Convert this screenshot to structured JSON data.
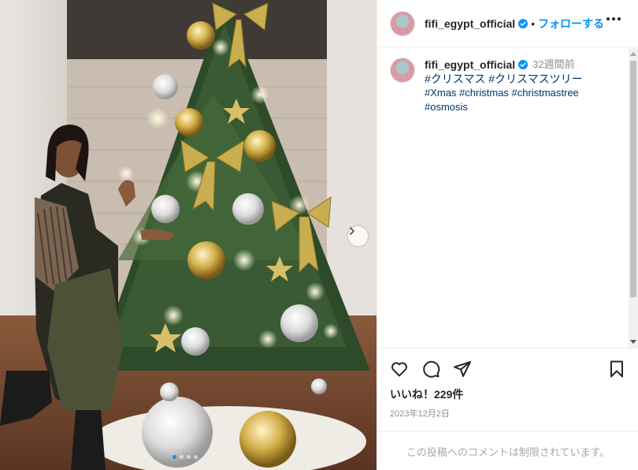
{
  "post": {
    "username": "fifi_egypt_official",
    "separator": "•",
    "follow_label": "フォローする",
    "caption_time": "32週間前",
    "hashtags_line1": "#クリスマス #クリスマスツリー",
    "hashtags_line2": "#Xmas #christmas #christmastree",
    "hashtags_line3": "#osmosis",
    "likes": "いいね！229件",
    "date": "2023年12月2日",
    "comments_restricted": "この投稿へのコメントは制限されています。"
  },
  "carousel": {
    "total": 4,
    "active_index": 0
  },
  "icons": [
    "more-options-icon",
    "heart-icon",
    "comment-icon",
    "share-icon",
    "save-icon",
    "chevron-right-icon",
    "verified-badge-icon"
  ],
  "colors": {
    "accent": "#0095f6",
    "hashtag": "#00376b",
    "muted": "#8e8e8e",
    "border": "#efefef"
  }
}
